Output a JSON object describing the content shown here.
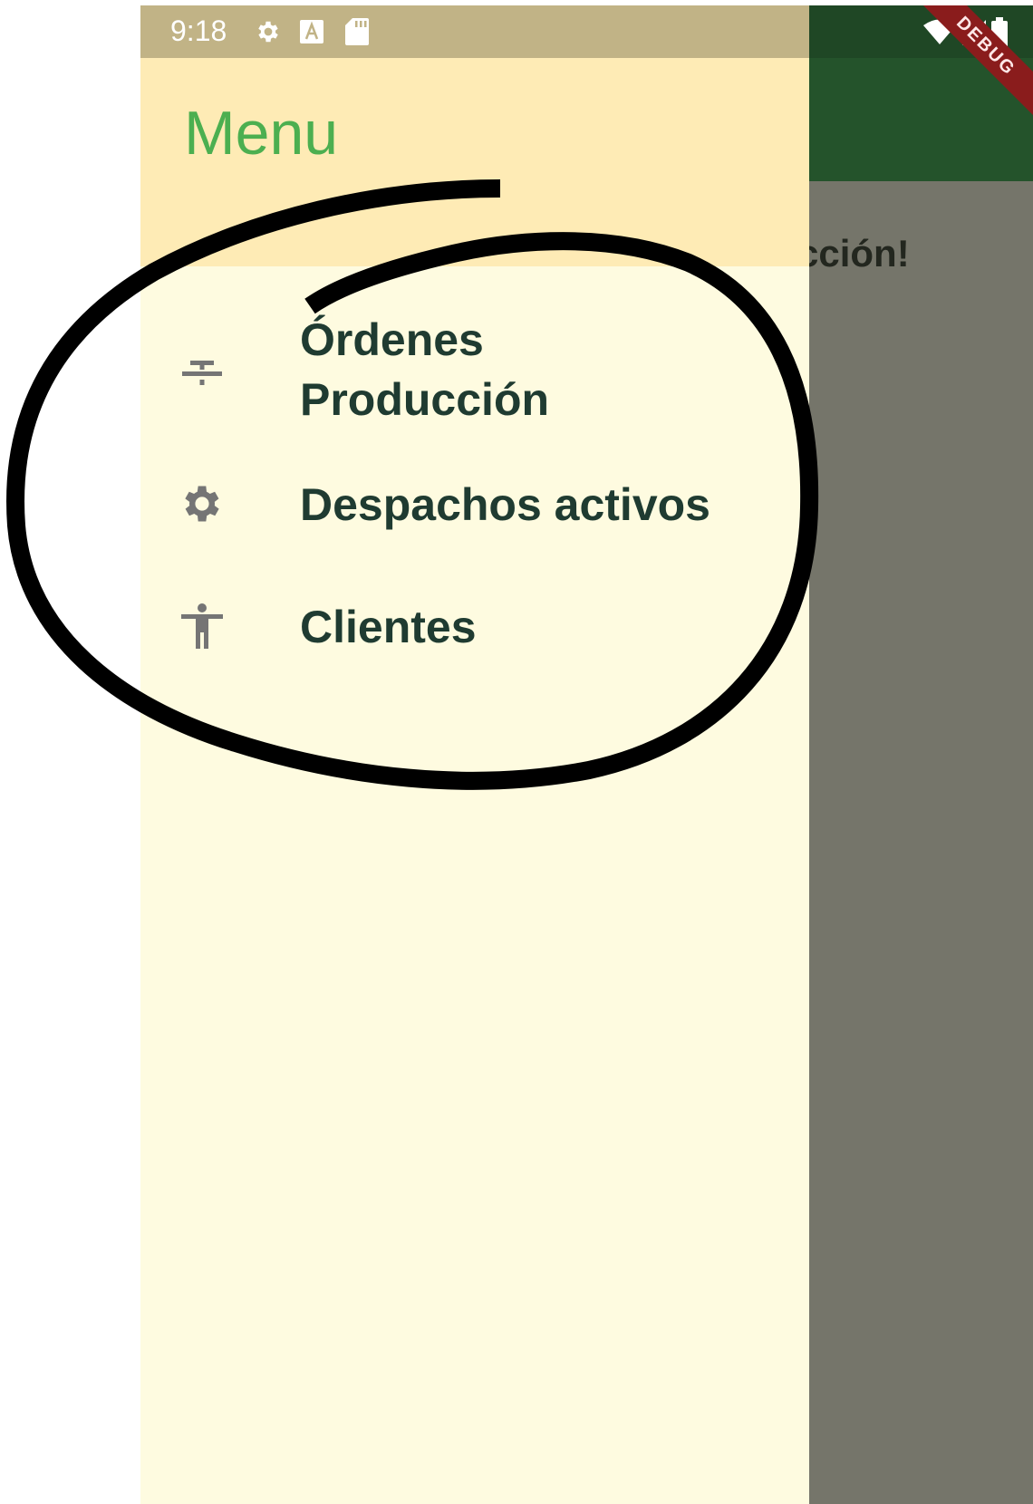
{
  "status_bar": {
    "time": "9:18",
    "icons_left": [
      "gear-icon",
      "a-icon",
      "sd-card-icon"
    ],
    "icons_right": [
      "wifi-icon",
      "cell-signal-icon",
      "battery-icon"
    ]
  },
  "app": {
    "body_text_partial": "cción!",
    "debug_banner": "DEBUG"
  },
  "drawer": {
    "header_title": "Menu",
    "items": [
      {
        "label": "Órdenes Producción",
        "icon": "strikethrough-icon"
      },
      {
        "label": "Despachos activos",
        "icon": "gear-icon"
      },
      {
        "label": "Clientes",
        "icon": "accessibility-icon"
      }
    ]
  },
  "colors": {
    "drawer_bg": "#fefbe0",
    "header_bg": "#feebb5",
    "title_green": "#4caf50",
    "app_bar_green": "#24532b",
    "scrim": "#75756a",
    "debug_red": "#8a1c1c"
  }
}
